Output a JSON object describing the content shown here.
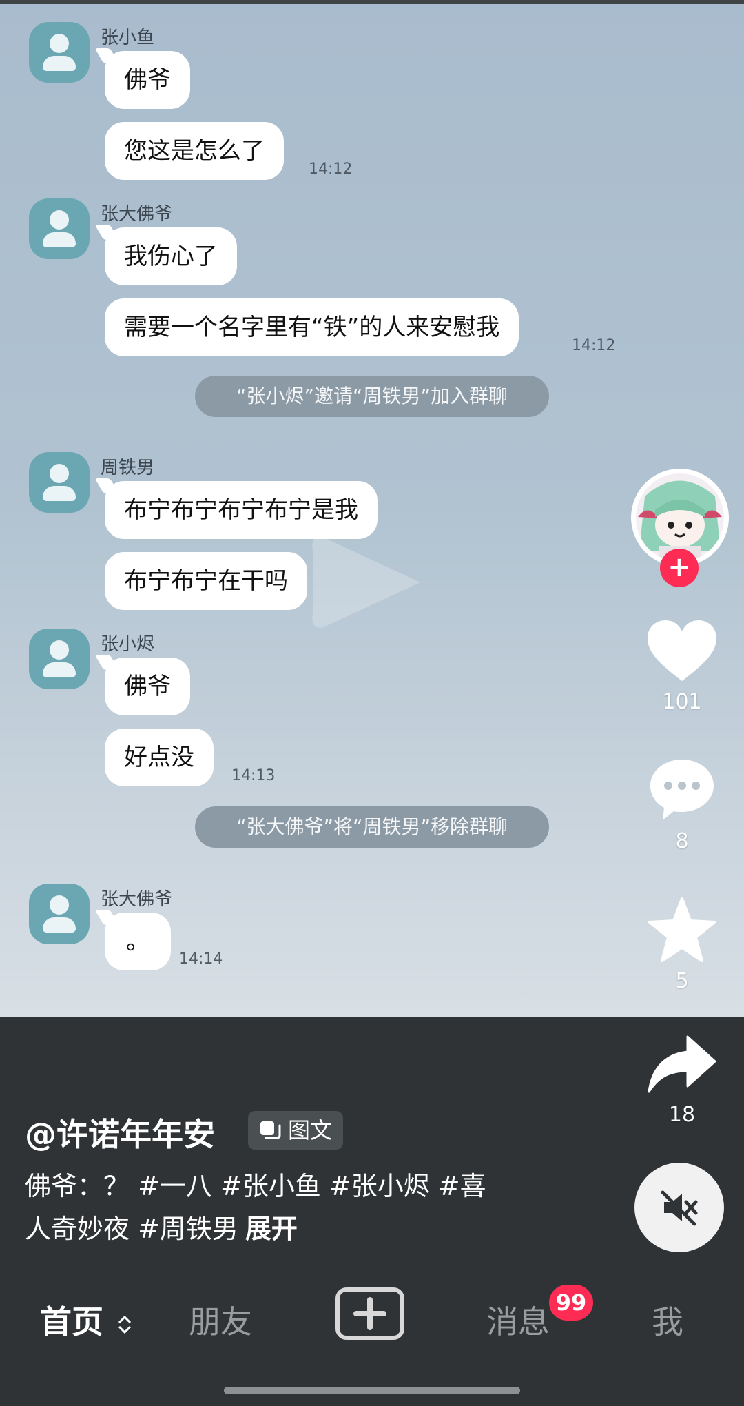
{
  "chat": {
    "messages": [
      {
        "sender": "张小鱼",
        "texts": [
          "佛爷",
          "您这是怎么了"
        ],
        "time": "14:12"
      },
      {
        "sender": "张大佛爷",
        "texts": [
          "我伤心了",
          "需要一个名字里有“铁”的人来安慰我"
        ],
        "time": "14:12"
      },
      {
        "system": "“张小烬”邀请“周铁男”加入群聊"
      },
      {
        "sender": "周铁男",
        "texts": [
          "布宁布宁布宁布宁是我",
          "布宁布宁在干吗"
        ]
      },
      {
        "sender": "张小烬",
        "texts": [
          "佛爷",
          "好点没"
        ],
        "time": "14:13"
      },
      {
        "system": "“张大佛爷”将“周铁男”移除群聊"
      },
      {
        "sender": "张大佛爷",
        "texts": [
          "。"
        ],
        "time": "14:14"
      }
    ]
  },
  "rail": {
    "like_count": "101",
    "comment_count": "8",
    "favorite_count": "5",
    "share_count": "18"
  },
  "post": {
    "author": "@许诺年年安",
    "type_tag": "图文",
    "caption_line1": "佛爷：？ #一八 #张小鱼 #张小烬 #喜",
    "caption_line2": "人奇妙夜 #周铁男",
    "expand_label": "展开"
  },
  "nav": {
    "home": "首页",
    "friends": "朋友",
    "messages": "消息",
    "messages_badge": "99",
    "me": "我"
  },
  "colors": {
    "accent_red": "#fe2c55",
    "chat_background": "#b1c3d1",
    "bar_background": "#2f3335"
  },
  "icons": [
    "person-avatar-icon",
    "play-icon",
    "heart-icon",
    "comment-dots-icon",
    "star-icon",
    "share-arrow-icon",
    "mute-speaker-icon",
    "plus-icon",
    "image-text-icon",
    "sort-arrows-icon"
  ]
}
